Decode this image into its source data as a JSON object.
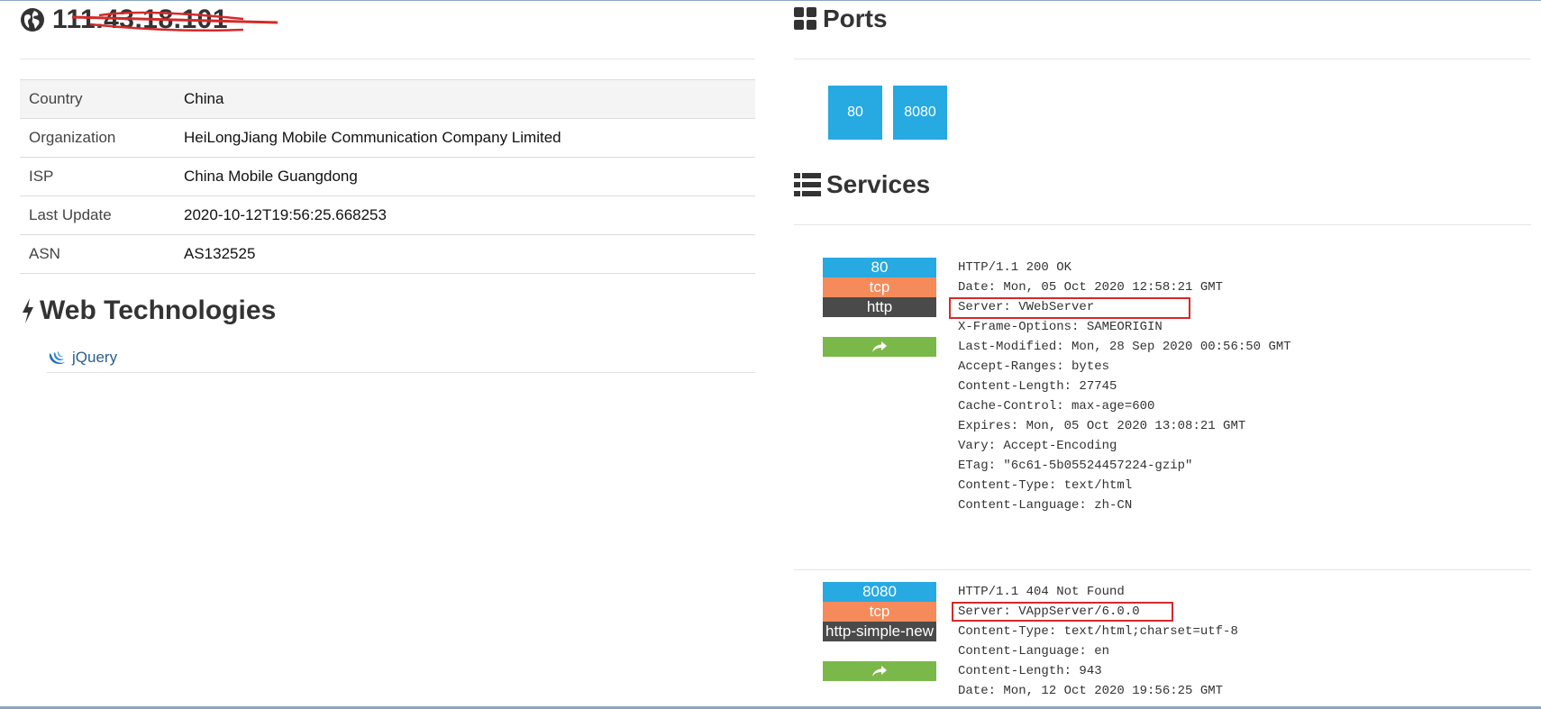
{
  "host": {
    "ip": "111.43.18.101"
  },
  "info_table": [
    {
      "key": "Country",
      "value": "China"
    },
    {
      "key": "Organization",
      "value": "HeiLongJiang Mobile Communication Company Limited"
    },
    {
      "key": "ISP",
      "value": "China Mobile Guangdong"
    },
    {
      "key": "Last Update",
      "value": "2020-10-12T19:56:25.668253"
    },
    {
      "key": "ASN",
      "value": "AS132525"
    }
  ],
  "web_tech": {
    "title": "Web Technologies",
    "items": [
      {
        "name": "jQuery",
        "icon": "jquery-icon"
      }
    ]
  },
  "ports": {
    "title": "Ports",
    "items": [
      "80",
      "8080"
    ]
  },
  "services": {
    "title": "Services",
    "items": [
      {
        "port": "80",
        "transport": "tcp",
        "module": "http",
        "lines": [
          "HTTP/1.1 200 OK",
          "Date: Mon, 05 Oct 2020 12:58:21 GMT",
          "Server: VWebServer",
          "X-Frame-Options: SAMEORIGIN",
          "Last-Modified: Mon, 28 Sep 2020 00:56:50 GMT",
          "Accept-Ranges: bytes",
          "Content-Length: 27745",
          "Cache-Control: max-age=600",
          "Expires: Mon, 05 Oct 2020 13:08:21 GMT",
          "Vary: Accept-Encoding",
          "ETag: \"6c61-5b05524457224-gzip\"",
          "Content-Type: text/html",
          "Content-Language: zh-CN"
        ]
      },
      {
        "port": "8080",
        "transport": "tcp",
        "module": "http-simple-new",
        "lines": [
          "HTTP/1.1 404 Not Found",
          "Server: VAppServer/6.0.0",
          "Content-Type: text/html;charset=utf-8",
          "Content-Language: en",
          "Content-Length: 943",
          "Date: Mon, 12 Oct 2020 19:56:25 GMT"
        ]
      }
    ]
  },
  "colors": {
    "port_blue": "#27a9e1",
    "tcp_orange": "#f58b5b",
    "module_dark": "#4a4a4a",
    "share_green": "#7bb84a",
    "highlight_red": "#d42a2a"
  }
}
